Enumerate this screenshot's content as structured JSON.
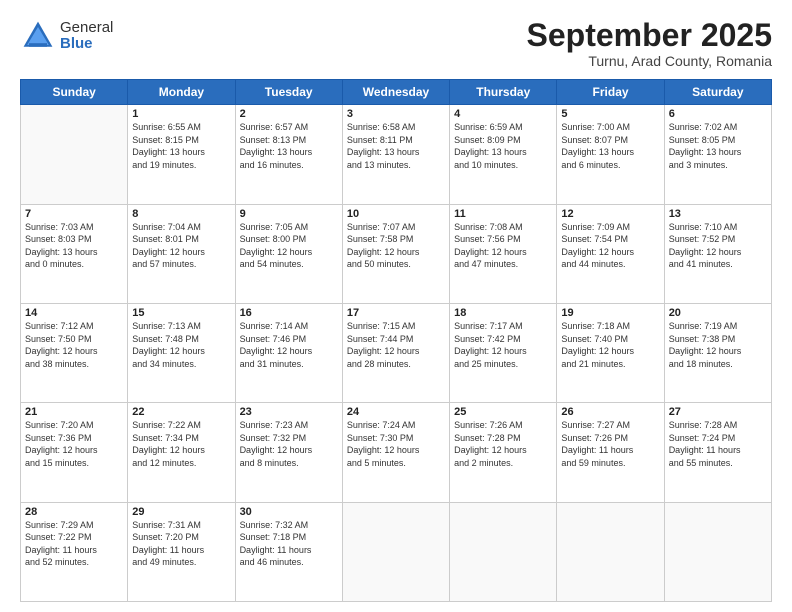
{
  "header": {
    "logo": {
      "general": "General",
      "blue": "Blue"
    },
    "title": "September 2025",
    "location": "Turnu, Arad County, Romania"
  },
  "weekdays": [
    "Sunday",
    "Monday",
    "Tuesday",
    "Wednesday",
    "Thursday",
    "Friday",
    "Saturday"
  ],
  "weeks": [
    [
      {
        "day": "",
        "info": ""
      },
      {
        "day": "1",
        "info": "Sunrise: 6:55 AM\nSunset: 8:15 PM\nDaylight: 13 hours\nand 19 minutes."
      },
      {
        "day": "2",
        "info": "Sunrise: 6:57 AM\nSunset: 8:13 PM\nDaylight: 13 hours\nand 16 minutes."
      },
      {
        "day": "3",
        "info": "Sunrise: 6:58 AM\nSunset: 8:11 PM\nDaylight: 13 hours\nand 13 minutes."
      },
      {
        "day": "4",
        "info": "Sunrise: 6:59 AM\nSunset: 8:09 PM\nDaylight: 13 hours\nand 10 minutes."
      },
      {
        "day": "5",
        "info": "Sunrise: 7:00 AM\nSunset: 8:07 PM\nDaylight: 13 hours\nand 6 minutes."
      },
      {
        "day": "6",
        "info": "Sunrise: 7:02 AM\nSunset: 8:05 PM\nDaylight: 13 hours\nand 3 minutes."
      }
    ],
    [
      {
        "day": "7",
        "info": "Sunrise: 7:03 AM\nSunset: 8:03 PM\nDaylight: 13 hours\nand 0 minutes."
      },
      {
        "day": "8",
        "info": "Sunrise: 7:04 AM\nSunset: 8:01 PM\nDaylight: 12 hours\nand 57 minutes."
      },
      {
        "day": "9",
        "info": "Sunrise: 7:05 AM\nSunset: 8:00 PM\nDaylight: 12 hours\nand 54 minutes."
      },
      {
        "day": "10",
        "info": "Sunrise: 7:07 AM\nSunset: 7:58 PM\nDaylight: 12 hours\nand 50 minutes."
      },
      {
        "day": "11",
        "info": "Sunrise: 7:08 AM\nSunset: 7:56 PM\nDaylight: 12 hours\nand 47 minutes."
      },
      {
        "day": "12",
        "info": "Sunrise: 7:09 AM\nSunset: 7:54 PM\nDaylight: 12 hours\nand 44 minutes."
      },
      {
        "day": "13",
        "info": "Sunrise: 7:10 AM\nSunset: 7:52 PM\nDaylight: 12 hours\nand 41 minutes."
      }
    ],
    [
      {
        "day": "14",
        "info": "Sunrise: 7:12 AM\nSunset: 7:50 PM\nDaylight: 12 hours\nand 38 minutes."
      },
      {
        "day": "15",
        "info": "Sunrise: 7:13 AM\nSunset: 7:48 PM\nDaylight: 12 hours\nand 34 minutes."
      },
      {
        "day": "16",
        "info": "Sunrise: 7:14 AM\nSunset: 7:46 PM\nDaylight: 12 hours\nand 31 minutes."
      },
      {
        "day": "17",
        "info": "Sunrise: 7:15 AM\nSunset: 7:44 PM\nDaylight: 12 hours\nand 28 minutes."
      },
      {
        "day": "18",
        "info": "Sunrise: 7:17 AM\nSunset: 7:42 PM\nDaylight: 12 hours\nand 25 minutes."
      },
      {
        "day": "19",
        "info": "Sunrise: 7:18 AM\nSunset: 7:40 PM\nDaylight: 12 hours\nand 21 minutes."
      },
      {
        "day": "20",
        "info": "Sunrise: 7:19 AM\nSunset: 7:38 PM\nDaylight: 12 hours\nand 18 minutes."
      }
    ],
    [
      {
        "day": "21",
        "info": "Sunrise: 7:20 AM\nSunset: 7:36 PM\nDaylight: 12 hours\nand 15 minutes."
      },
      {
        "day": "22",
        "info": "Sunrise: 7:22 AM\nSunset: 7:34 PM\nDaylight: 12 hours\nand 12 minutes."
      },
      {
        "day": "23",
        "info": "Sunrise: 7:23 AM\nSunset: 7:32 PM\nDaylight: 12 hours\nand 8 minutes."
      },
      {
        "day": "24",
        "info": "Sunrise: 7:24 AM\nSunset: 7:30 PM\nDaylight: 12 hours\nand 5 minutes."
      },
      {
        "day": "25",
        "info": "Sunrise: 7:26 AM\nSunset: 7:28 PM\nDaylight: 12 hours\nand 2 minutes."
      },
      {
        "day": "26",
        "info": "Sunrise: 7:27 AM\nSunset: 7:26 PM\nDaylight: 11 hours\nand 59 minutes."
      },
      {
        "day": "27",
        "info": "Sunrise: 7:28 AM\nSunset: 7:24 PM\nDaylight: 11 hours\nand 55 minutes."
      }
    ],
    [
      {
        "day": "28",
        "info": "Sunrise: 7:29 AM\nSunset: 7:22 PM\nDaylight: 11 hours\nand 52 minutes."
      },
      {
        "day": "29",
        "info": "Sunrise: 7:31 AM\nSunset: 7:20 PM\nDaylight: 11 hours\nand 49 minutes."
      },
      {
        "day": "30",
        "info": "Sunrise: 7:32 AM\nSunset: 7:18 PM\nDaylight: 11 hours\nand 46 minutes."
      },
      {
        "day": "",
        "info": ""
      },
      {
        "day": "",
        "info": ""
      },
      {
        "day": "",
        "info": ""
      },
      {
        "day": "",
        "info": ""
      }
    ]
  ]
}
